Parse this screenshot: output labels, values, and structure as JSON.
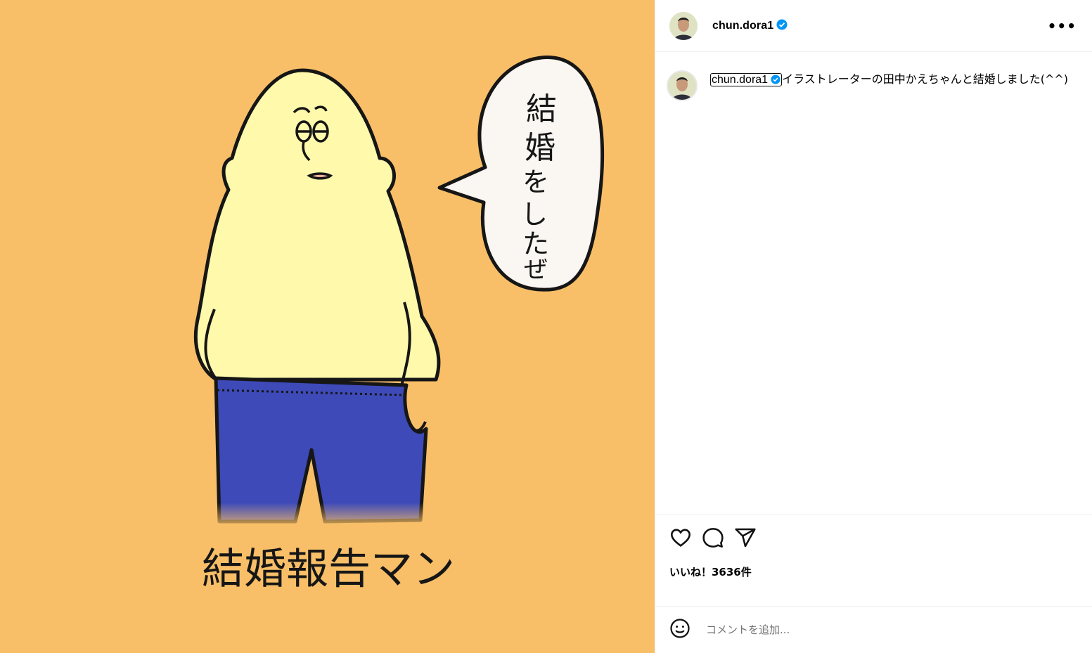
{
  "post": {
    "username": "chun.dora1",
    "verified": true,
    "caption": "イラストレーターの田中かえちゃんと結婚しました(^^)"
  },
  "artwork": {
    "bubble_text": [
      "結",
      "婚",
      "を",
      "し",
      "た",
      "ぜ"
    ],
    "title_text": "結婚報告マン"
  },
  "header": {
    "more_label": "•••"
  },
  "actions": {
    "likes_text": "いいね！3636件"
  },
  "comment": {
    "placeholder": "コメントを追加..."
  },
  "colors": {
    "background": "#f8bf68",
    "body": "#fff8aa",
    "pants": "#3d4ab8",
    "verified": "#0095f6"
  },
  "icons": [
    "more-icon",
    "verified-icon",
    "like-icon",
    "comment-icon",
    "share-icon",
    "emoji-icon"
  ]
}
